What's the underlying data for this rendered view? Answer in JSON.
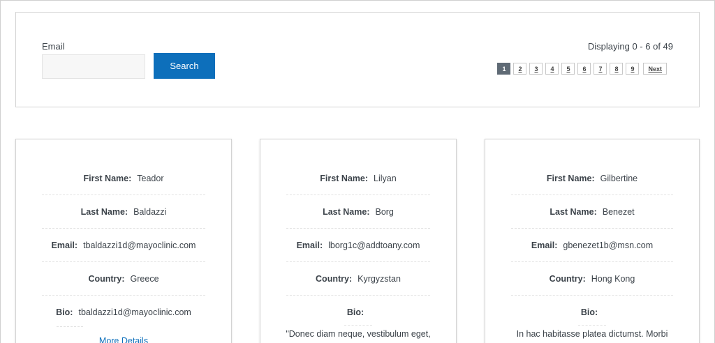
{
  "search": {
    "email_label": "Email",
    "email_value": "",
    "email_placeholder": "",
    "button_label": "Search"
  },
  "summary": {
    "displaying_text": "Displaying 0 - 6 of 49"
  },
  "pagination": {
    "pages": [
      "1",
      "2",
      "3",
      "4",
      "5",
      "6",
      "7",
      "8",
      "9"
    ],
    "active": "1",
    "next_label": "Next"
  },
  "labels": {
    "first_name": "First Name:",
    "last_name": "Last Name:",
    "email": "Email:",
    "country": "Country:",
    "bio": "Bio:",
    "more_details": "More Details"
  },
  "cards": [
    {
      "first_name": "Teador",
      "last_name": "Baldazzi",
      "email": "tbaldazzi1d@mayoclinic.com",
      "country": "Greece",
      "bio": "tbaldazzi1d@mayoclinic.com"
    },
    {
      "first_name": "Lilyan",
      "last_name": "Borg",
      "email": "lborg1c@addtoany.com",
      "country": "Kyrgyzstan",
      "bio": "\"Donec diam neque, vestibulum eget,"
    },
    {
      "first_name": "Gilbertine",
      "last_name": "Benezet",
      "email": "gbenezet1b@msn.com",
      "country": "Hong Kong",
      "bio": "In hac habitasse platea dictumst. Morbi"
    }
  ]
}
